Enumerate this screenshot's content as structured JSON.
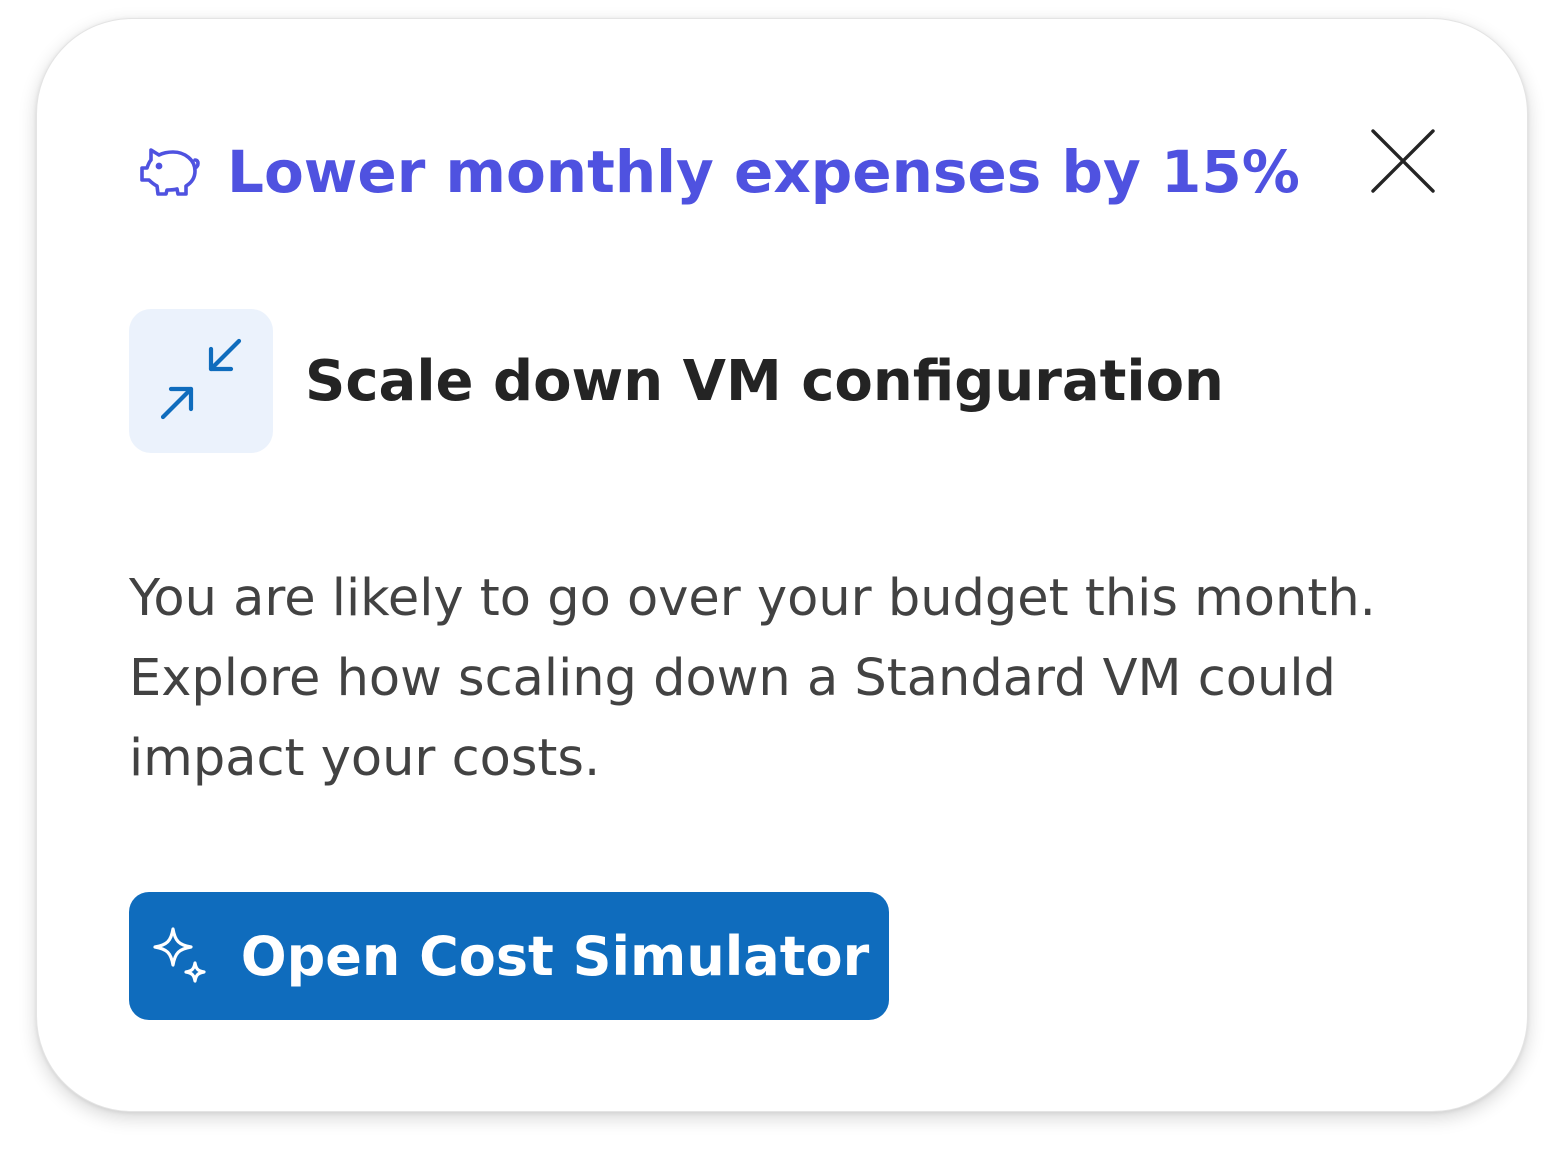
{
  "card": {
    "header": {
      "icon": "piggy-bank-icon",
      "title": "Lower monthly expenses by 15%",
      "close_icon": "close-icon"
    },
    "recommendation": {
      "icon": "arrow-minimize-icon",
      "title": "Scale down VM configuration"
    },
    "description": "You are likely to go over your budget this month. Explore how scaling down a Standard VM could impact your costs.",
    "cta": {
      "icon": "sparkle-icon",
      "label": "Open Cost Simulator"
    }
  },
  "colors": {
    "title_accent": "#4f52e0",
    "primary_button": "#0f6cbd",
    "icon_tile_bg": "#ebf2fc",
    "icon_blue": "#0f6cbd",
    "heading_text": "#242424",
    "body_text": "#424242"
  }
}
